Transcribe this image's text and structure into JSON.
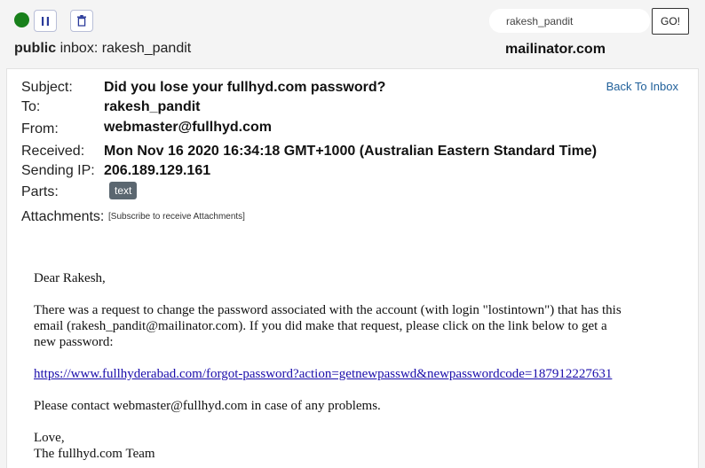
{
  "toolbar": {
    "status_color": "#18801b",
    "pause_icon": "pause-icon",
    "trash_icon": "trash-icon"
  },
  "inbox": {
    "visibility": "public",
    "label_suffix": "inbox: rakesh_pandit"
  },
  "search": {
    "value": "rakesh_pandit",
    "go_label": "GO!"
  },
  "brand": "mailinator.com",
  "message": {
    "back_label": "Back To Inbox",
    "fields": {
      "subject_label": "Subject:",
      "subject": "Did you lose your fullhyd.com password?",
      "to_label": "To:",
      "to": "rakesh_pandit",
      "from_label": "From:",
      "from": "webmaster@fullhyd.com",
      "received_label": "Received:",
      "received": "Mon Nov 16 2020 16:34:18 GMT+1000 (Australian Eastern Standard Time)",
      "ip_label": "Sending IP:",
      "ip": "206.189.129.161",
      "parts_label": "Parts:",
      "part": "text",
      "attachments_label": "Attachments:",
      "attachments_note": "[Subscribe to receive Attachments]"
    },
    "body": {
      "greeting": "Dear Rakesh,",
      "paragraph_line1": "There was a request to change the password associated with the account (with login \"lostintown\") that has this",
      "paragraph_line2": "email (rakesh_pandit@mailinator.com). If you did make that request, please click on the link below to get a",
      "paragraph_line3": "new password:",
      "link": "https://www.fullhyderabad.com/forgot-password?action=getnewpasswd&newpasswordcode=187912227631",
      "contact": "Please contact webmaster@fullhyd.com in case of any problems.",
      "signoff": "Love,",
      "signature": "The fullhyd.com Team"
    }
  }
}
